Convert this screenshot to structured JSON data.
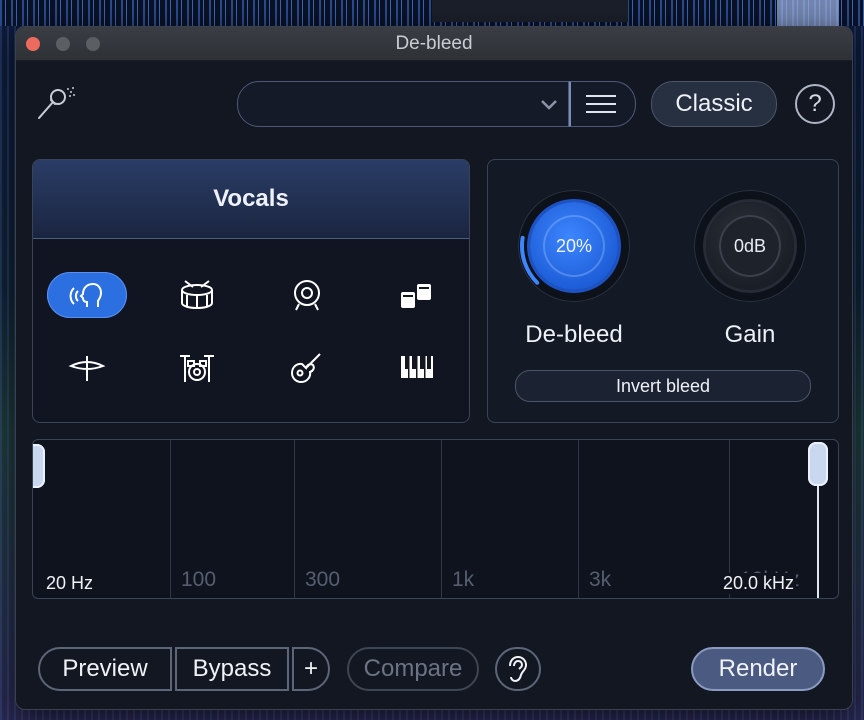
{
  "window": {
    "title": "De-bleed"
  },
  "toolbar": {
    "preset_value": "",
    "classic_label": "Classic",
    "help_label": "?"
  },
  "source_panel": {
    "title": "Vocals",
    "instruments": [
      {
        "icon": "voice-icon",
        "selected": true
      },
      {
        "icon": "snare-drum-icon",
        "selected": false
      },
      {
        "icon": "kick-drum-icon",
        "selected": false
      },
      {
        "icon": "toms-icon",
        "selected": false
      },
      {
        "icon": "cymbal-icon",
        "selected": false
      },
      {
        "icon": "drum-kit-icon",
        "selected": false
      },
      {
        "icon": "acoustic-guitar-icon",
        "selected": false
      },
      {
        "icon": "piano-keys-icon",
        "selected": false
      }
    ]
  },
  "controls": {
    "debleed": {
      "value": "20%",
      "label": "De-bleed",
      "level": 0.2
    },
    "gain": {
      "value": "0dB",
      "label": "Gain"
    },
    "invert_label": "Invert bleed"
  },
  "frequency": {
    "low_value": "20 Hz",
    "high_value": "20.0 kHz",
    "ticks": [
      "100",
      "300",
      "1k",
      "3k",
      "10kHz"
    ]
  },
  "footer": {
    "preview_label": "Preview",
    "bypass_label": "Bypass",
    "plus_label": "+",
    "compare_label": "Compare",
    "render_label": "Render"
  },
  "colors": {
    "accent": "#2c6fe0",
    "panel": "#121722"
  }
}
